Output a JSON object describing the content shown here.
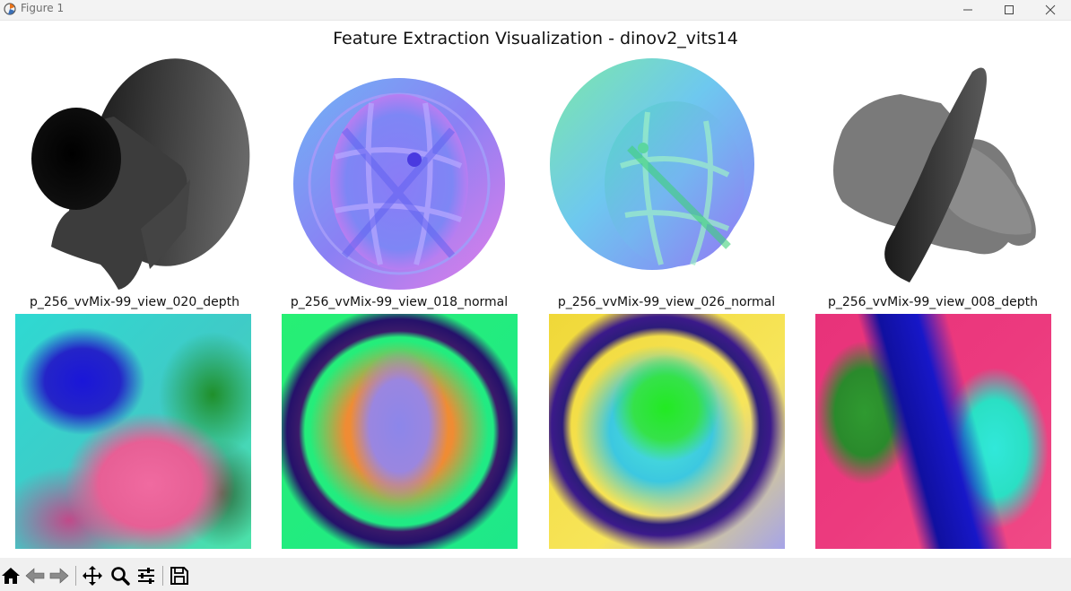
{
  "window": {
    "title": "Figure 1"
  },
  "figure": {
    "title": "Feature Extraction Visualization - dinov2_vits14",
    "panels": [
      {
        "label": "p_256_vvMix-99_view_020_depth"
      },
      {
        "label": "p_256_vvMix-99_view_018_normal"
      },
      {
        "label": "p_256_vvMix-99_view_026_normal"
      },
      {
        "label": "p_256_vvMix-99_view_008_depth"
      }
    ]
  },
  "toolbar": {
    "buttons": [
      "home-icon",
      "back-arrow-icon",
      "forward-arrow-icon",
      "pan-move-icon",
      "zoom-magnifier-icon",
      "configure-subplots-icon",
      "save-floppy-icon"
    ]
  }
}
